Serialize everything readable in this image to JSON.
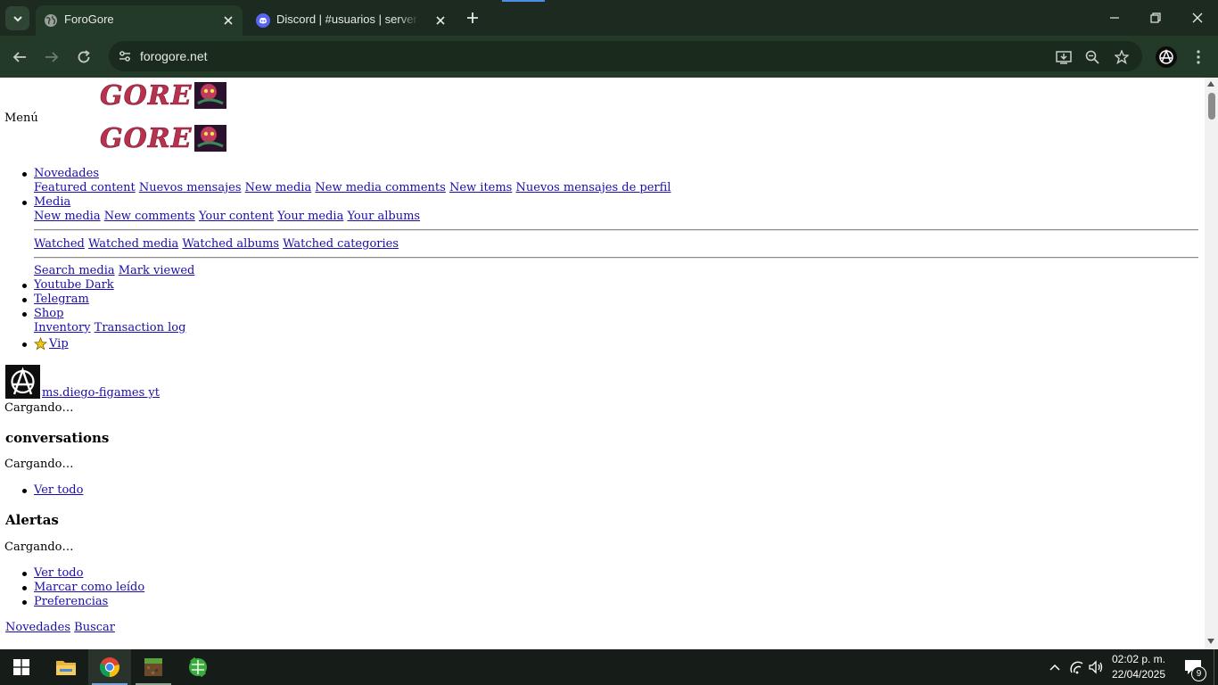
{
  "browser": {
    "tabs": [
      {
        "title": "ForoGore",
        "active": true,
        "favicon": "globe-icon"
      },
      {
        "title": "Discord | #usuarios | server do tchola",
        "active": false,
        "favicon": "discord-icon"
      }
    ],
    "address": {
      "url": "forogore.net"
    },
    "accent_color": "#243a28"
  },
  "page": {
    "menu_label": "Menú",
    "logo_alt": "GORE",
    "nav": {
      "novedades": {
        "label": "Novedades",
        "subitems": [
          "Featured content",
          "Nuevos mensajes",
          "New media",
          "New media comments",
          "New items",
          "Nuevos mensajes de perfil"
        ]
      },
      "media": {
        "label": "Media",
        "row1": [
          "New media",
          "New comments",
          "Your content",
          "Your media",
          "Your albums"
        ],
        "row2": [
          "Watched",
          "Watched media",
          "Watched albums",
          "Watched categories"
        ],
        "row3": [
          "Search media",
          "Mark viewed"
        ]
      },
      "youtube": "Youtube Dark",
      "telegram": "Telegram",
      "shop": {
        "label": "Shop",
        "subitems": [
          "Inventory",
          "Transaction log"
        ]
      },
      "vip": "Vip"
    },
    "user": {
      "name": "ms.diego-figames yt",
      "loading": "Cargando…"
    },
    "conversations": {
      "heading": "conversations",
      "loading": "Cargando…",
      "links": [
        "Ver todo"
      ]
    },
    "alerts": {
      "heading": "Alertas",
      "loading": "Cargando…",
      "links": [
        "Ver todo",
        "Marcar como leído",
        "Preferencias"
      ]
    },
    "footer_links": [
      "Novedades",
      "Buscar"
    ]
  },
  "taskbar": {
    "time": "02:02 p. m.",
    "date": "22/04/2025",
    "notification_count": "9"
  }
}
